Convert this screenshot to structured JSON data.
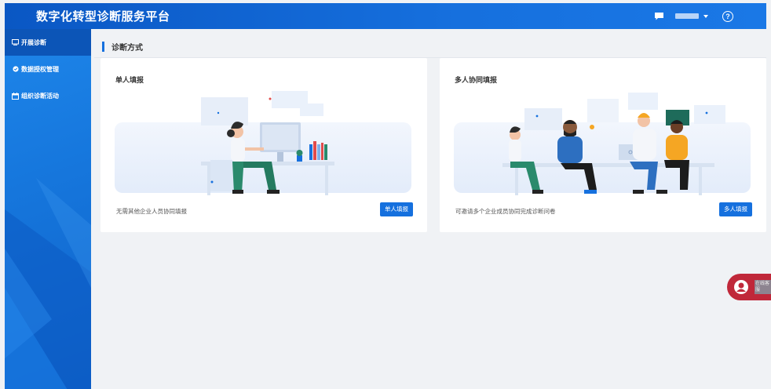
{
  "header": {
    "title": "数字化转型诊断服务平台",
    "icons": {
      "message": "chat-icon",
      "help": "help-circle-icon"
    },
    "help_glyph": "?"
  },
  "sidebar": {
    "items": [
      {
        "label": "开展诊断",
        "icon": "monitor-icon",
        "active": true
      },
      {
        "label": "数据授权管理",
        "icon": "shield-icon",
        "active": false
      },
      {
        "label": "组织诊断活动",
        "icon": "calendar-icon",
        "active": false
      }
    ]
  },
  "main": {
    "section_title": "诊断方式",
    "cards": [
      {
        "title": "单人填报",
        "description": "无需其他企业人员协同填报",
        "button": "单人填报"
      },
      {
        "title": "多人协同填报",
        "description": "可邀请多个企业成员协同完成诊断问卷",
        "button": "多人填报"
      }
    ]
  },
  "float_service": {
    "label": "在线客服"
  },
  "colors": {
    "primary": "#1570de",
    "header": "#0a57c4",
    "float": "#c0283a"
  }
}
